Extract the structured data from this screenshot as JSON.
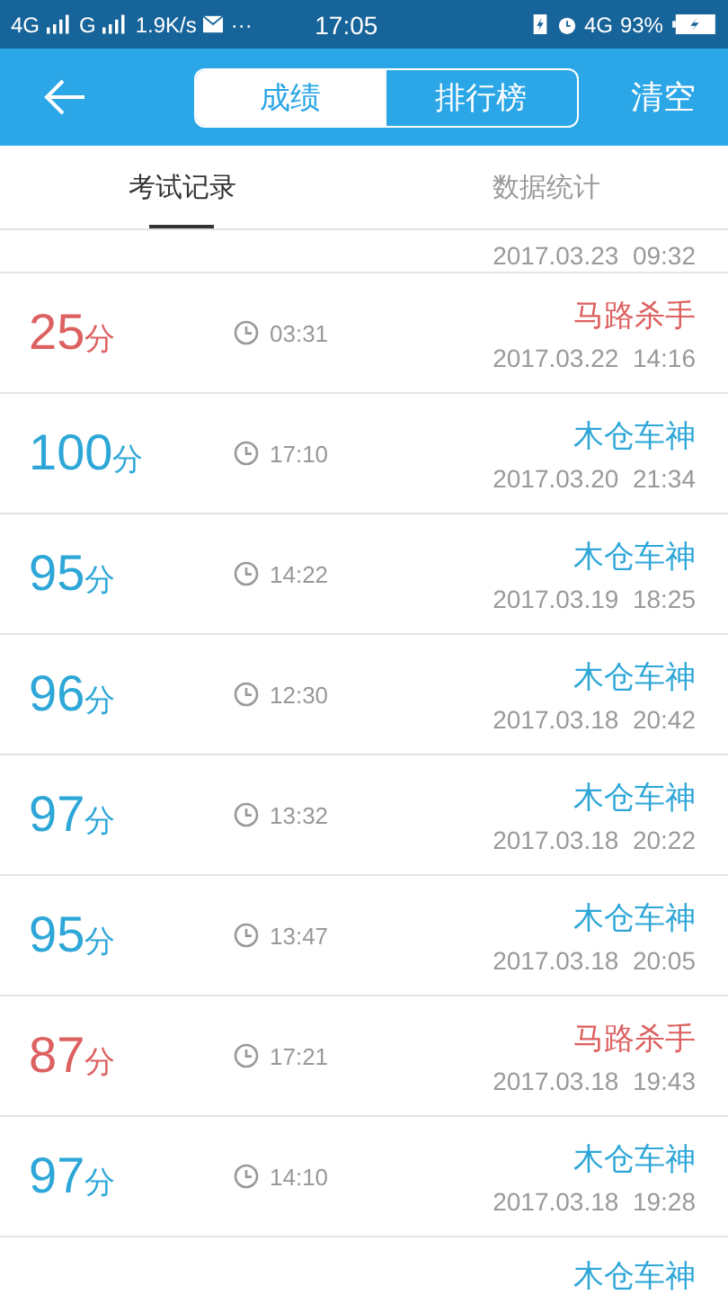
{
  "status_bar": {
    "network_1": "4G",
    "network_2": "G",
    "speed": "1.9K/s",
    "more": "···",
    "time": "17:05",
    "network_3": "4G",
    "battery": "93%"
  },
  "header": {
    "segments": [
      {
        "label": "成绩",
        "selected": true
      },
      {
        "label": "排行榜",
        "selected": false
      }
    ],
    "action": "清空"
  },
  "tabs": [
    {
      "label": "考试记录",
      "selected": true
    },
    {
      "label": "数据统计",
      "selected": false
    }
  ],
  "records": [
    {
      "date": "2017.03.23  09:32"
    },
    {
      "score": "25",
      "unit": "分",
      "duration": "03:31",
      "title": "马路杀手",
      "date": "2017.03.22  14:16",
      "color": "#dc6160"
    },
    {
      "score": "100",
      "unit": "分",
      "duration": "17:10",
      "title": "木仓车神",
      "date": "2017.03.20  21:34",
      "color": "#2ea7d8"
    },
    {
      "score": "95",
      "unit": "分",
      "duration": "14:22",
      "title": "木仓车神",
      "date": "2017.03.19  18:25",
      "color": "#2ea7d8"
    },
    {
      "score": "96",
      "unit": "分",
      "duration": "12:30",
      "title": "木仓车神",
      "date": "2017.03.18  20:42",
      "color": "#2ea7d8"
    },
    {
      "score": "97",
      "unit": "分",
      "duration": "13:32",
      "title": "木仓车神",
      "date": "2017.03.18  20:22",
      "color": "#2ea7d8"
    },
    {
      "score": "95",
      "unit": "分",
      "duration": "13:47",
      "title": "木仓车神",
      "date": "2017.03.18  20:05",
      "color": "#2ea7d8"
    },
    {
      "score": "87",
      "unit": "分",
      "duration": "17:21",
      "title": "马路杀手",
      "date": "2017.03.18  19:43",
      "color": "#dc6160"
    },
    {
      "score": "97",
      "unit": "分",
      "duration": "14:10",
      "title": "木仓车神",
      "date": "2017.03.18  19:28",
      "color": "#2ea7d8"
    },
    {
      "title": "木仓车神",
      "color": "#2ea7d8"
    }
  ]
}
